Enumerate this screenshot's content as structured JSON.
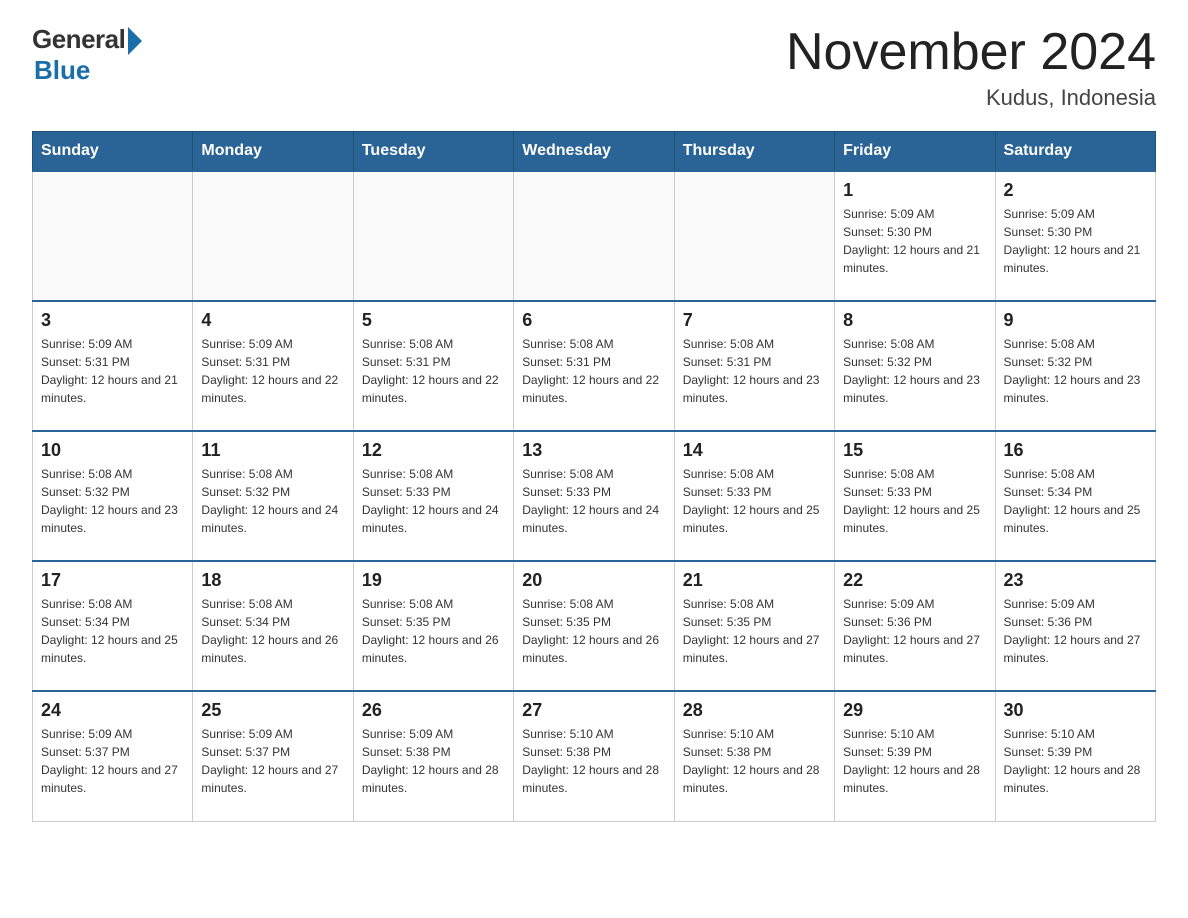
{
  "header": {
    "logo_general": "General",
    "logo_blue": "Blue",
    "logo_sub": "Blue",
    "title": "November 2024",
    "location": "Kudus, Indonesia"
  },
  "days_of_week": [
    "Sunday",
    "Monday",
    "Tuesday",
    "Wednesday",
    "Thursday",
    "Friday",
    "Saturday"
  ],
  "weeks": [
    [
      {
        "day": "",
        "sunrise": "",
        "sunset": "",
        "daylight": ""
      },
      {
        "day": "",
        "sunrise": "",
        "sunset": "",
        "daylight": ""
      },
      {
        "day": "",
        "sunrise": "",
        "sunset": "",
        "daylight": ""
      },
      {
        "day": "",
        "sunrise": "",
        "sunset": "",
        "daylight": ""
      },
      {
        "day": "",
        "sunrise": "",
        "sunset": "",
        "daylight": ""
      },
      {
        "day": "1",
        "sunrise": "Sunrise: 5:09 AM",
        "sunset": "Sunset: 5:30 PM",
        "daylight": "Daylight: 12 hours and 21 minutes."
      },
      {
        "day": "2",
        "sunrise": "Sunrise: 5:09 AM",
        "sunset": "Sunset: 5:30 PM",
        "daylight": "Daylight: 12 hours and 21 minutes."
      }
    ],
    [
      {
        "day": "3",
        "sunrise": "Sunrise: 5:09 AM",
        "sunset": "Sunset: 5:31 PM",
        "daylight": "Daylight: 12 hours and 21 minutes."
      },
      {
        "day": "4",
        "sunrise": "Sunrise: 5:09 AM",
        "sunset": "Sunset: 5:31 PM",
        "daylight": "Daylight: 12 hours and 22 minutes."
      },
      {
        "day": "5",
        "sunrise": "Sunrise: 5:08 AM",
        "sunset": "Sunset: 5:31 PM",
        "daylight": "Daylight: 12 hours and 22 minutes."
      },
      {
        "day": "6",
        "sunrise": "Sunrise: 5:08 AM",
        "sunset": "Sunset: 5:31 PM",
        "daylight": "Daylight: 12 hours and 22 minutes."
      },
      {
        "day": "7",
        "sunrise": "Sunrise: 5:08 AM",
        "sunset": "Sunset: 5:31 PM",
        "daylight": "Daylight: 12 hours and 23 minutes."
      },
      {
        "day": "8",
        "sunrise": "Sunrise: 5:08 AM",
        "sunset": "Sunset: 5:32 PM",
        "daylight": "Daylight: 12 hours and 23 minutes."
      },
      {
        "day": "9",
        "sunrise": "Sunrise: 5:08 AM",
        "sunset": "Sunset: 5:32 PM",
        "daylight": "Daylight: 12 hours and 23 minutes."
      }
    ],
    [
      {
        "day": "10",
        "sunrise": "Sunrise: 5:08 AM",
        "sunset": "Sunset: 5:32 PM",
        "daylight": "Daylight: 12 hours and 23 minutes."
      },
      {
        "day": "11",
        "sunrise": "Sunrise: 5:08 AM",
        "sunset": "Sunset: 5:32 PM",
        "daylight": "Daylight: 12 hours and 24 minutes."
      },
      {
        "day": "12",
        "sunrise": "Sunrise: 5:08 AM",
        "sunset": "Sunset: 5:33 PM",
        "daylight": "Daylight: 12 hours and 24 minutes."
      },
      {
        "day": "13",
        "sunrise": "Sunrise: 5:08 AM",
        "sunset": "Sunset: 5:33 PM",
        "daylight": "Daylight: 12 hours and 24 minutes."
      },
      {
        "day": "14",
        "sunrise": "Sunrise: 5:08 AM",
        "sunset": "Sunset: 5:33 PM",
        "daylight": "Daylight: 12 hours and 25 minutes."
      },
      {
        "day": "15",
        "sunrise": "Sunrise: 5:08 AM",
        "sunset": "Sunset: 5:33 PM",
        "daylight": "Daylight: 12 hours and 25 minutes."
      },
      {
        "day": "16",
        "sunrise": "Sunrise: 5:08 AM",
        "sunset": "Sunset: 5:34 PM",
        "daylight": "Daylight: 12 hours and 25 minutes."
      }
    ],
    [
      {
        "day": "17",
        "sunrise": "Sunrise: 5:08 AM",
        "sunset": "Sunset: 5:34 PM",
        "daylight": "Daylight: 12 hours and 25 minutes."
      },
      {
        "day": "18",
        "sunrise": "Sunrise: 5:08 AM",
        "sunset": "Sunset: 5:34 PM",
        "daylight": "Daylight: 12 hours and 26 minutes."
      },
      {
        "day": "19",
        "sunrise": "Sunrise: 5:08 AM",
        "sunset": "Sunset: 5:35 PM",
        "daylight": "Daylight: 12 hours and 26 minutes."
      },
      {
        "day": "20",
        "sunrise": "Sunrise: 5:08 AM",
        "sunset": "Sunset: 5:35 PM",
        "daylight": "Daylight: 12 hours and 26 minutes."
      },
      {
        "day": "21",
        "sunrise": "Sunrise: 5:08 AM",
        "sunset": "Sunset: 5:35 PM",
        "daylight": "Daylight: 12 hours and 27 minutes."
      },
      {
        "day": "22",
        "sunrise": "Sunrise: 5:09 AM",
        "sunset": "Sunset: 5:36 PM",
        "daylight": "Daylight: 12 hours and 27 minutes."
      },
      {
        "day": "23",
        "sunrise": "Sunrise: 5:09 AM",
        "sunset": "Sunset: 5:36 PM",
        "daylight": "Daylight: 12 hours and 27 minutes."
      }
    ],
    [
      {
        "day": "24",
        "sunrise": "Sunrise: 5:09 AM",
        "sunset": "Sunset: 5:37 PM",
        "daylight": "Daylight: 12 hours and 27 minutes."
      },
      {
        "day": "25",
        "sunrise": "Sunrise: 5:09 AM",
        "sunset": "Sunset: 5:37 PM",
        "daylight": "Daylight: 12 hours and 27 minutes."
      },
      {
        "day": "26",
        "sunrise": "Sunrise: 5:09 AM",
        "sunset": "Sunset: 5:38 PM",
        "daylight": "Daylight: 12 hours and 28 minutes."
      },
      {
        "day": "27",
        "sunrise": "Sunrise: 5:10 AM",
        "sunset": "Sunset: 5:38 PM",
        "daylight": "Daylight: 12 hours and 28 minutes."
      },
      {
        "day": "28",
        "sunrise": "Sunrise: 5:10 AM",
        "sunset": "Sunset: 5:38 PM",
        "daylight": "Daylight: 12 hours and 28 minutes."
      },
      {
        "day": "29",
        "sunrise": "Sunrise: 5:10 AM",
        "sunset": "Sunset: 5:39 PM",
        "daylight": "Daylight: 12 hours and 28 minutes."
      },
      {
        "day": "30",
        "sunrise": "Sunrise: 5:10 AM",
        "sunset": "Sunset: 5:39 PM",
        "daylight": "Daylight: 12 hours and 28 minutes."
      }
    ]
  ]
}
